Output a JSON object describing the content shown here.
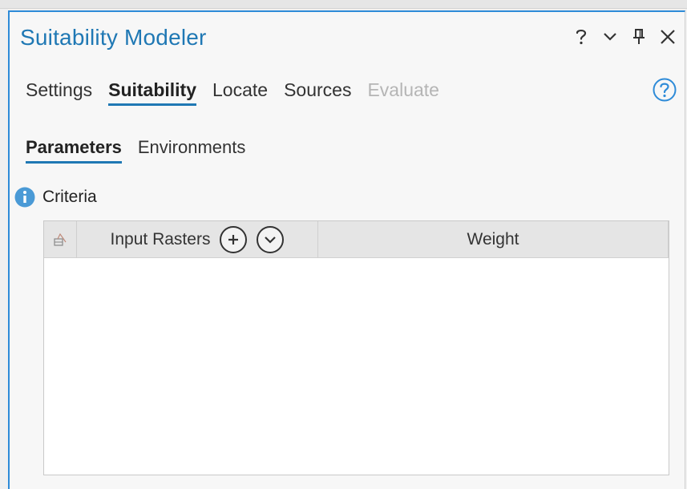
{
  "window": {
    "title": "Suitability Modeler",
    "controls": [
      {
        "name": "help-question",
        "icon": "question-mark-icon"
      },
      {
        "name": "options-menu",
        "icon": "chevron-down-icon"
      },
      {
        "name": "pin",
        "icon": "pin-icon"
      },
      {
        "name": "close",
        "icon": "close-icon"
      }
    ]
  },
  "tabs": [
    {
      "label": "Settings",
      "state": "normal"
    },
    {
      "label": "Suitability",
      "state": "active"
    },
    {
      "label": "Locate",
      "state": "normal"
    },
    {
      "label": "Sources",
      "state": "normal"
    },
    {
      "label": "Evaluate",
      "state": "disabled"
    }
  ],
  "subtabs": [
    {
      "label": "Parameters",
      "state": "active"
    },
    {
      "label": "Environments",
      "state": "normal"
    }
  ],
  "criteria": {
    "label": "Criteria",
    "table": {
      "columns": [
        "Input Rasters",
        "Weight"
      ],
      "rows": []
    }
  },
  "colors": {
    "accent": "#1f78b4",
    "info_blue": "#4a9ad6",
    "disabled_text": "#b5b5b5"
  }
}
